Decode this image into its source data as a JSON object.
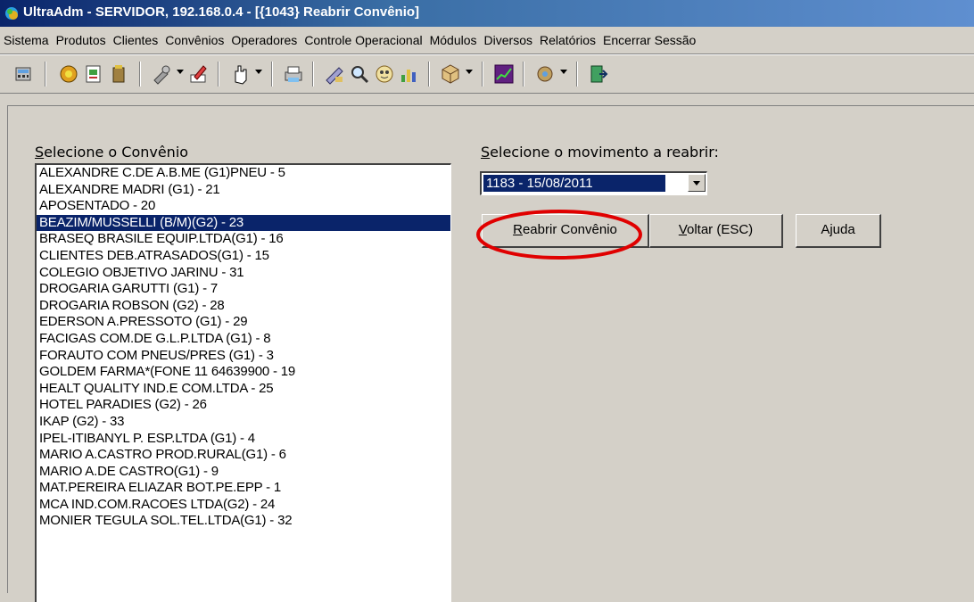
{
  "window": {
    "title": "UltraAdm - SERVIDOR, 192.168.0.4 - [{1043} Reabrir Convênio]"
  },
  "menu": [
    "Sistema",
    "Produtos",
    "Clientes",
    "Convênios",
    "Operadores",
    "Controle Operacional",
    "Módulos",
    "Diversos",
    "Relatórios",
    "Encerrar Sessão"
  ],
  "toolbar": {
    "icons": [
      "calculator-icon",
      "globe-icon",
      "document-icon",
      "trash-icon",
      "tools-icon",
      "edit-icon",
      "hand-icon",
      "printer-icon",
      "pencil-icon",
      "search-icon",
      "people-icon",
      "chart-icon",
      "cube-icon",
      "graph-icon",
      "settings-icon",
      "exit-icon"
    ]
  },
  "form": {
    "convenio_label_accel": "S",
    "convenio_label_rest": "elecione o Convênio",
    "movimento_label_accel": "S",
    "movimento_label_rest": "elecione o movimento a reabrir:",
    "movimento_value": "1183 - 15/08/2011",
    "buttons": {
      "reabrir_accel": "R",
      "reabrir_rest": "eabrir Convênio",
      "voltar_accel": "V",
      "voltar_rest": "oltar (ESC)",
      "ajuda": "Ajuda"
    },
    "highlight_color": "#e00000",
    "selected_color": "#0a246a",
    "convenios": [
      "ALEXANDRE C.DE A.B.ME (G1)PNEU - 5",
      "ALEXANDRE MADRI (G1) - 21",
      "APOSENTADO - 20",
      "BEAZIM/MUSSELLI (B/M)(G2) - 23",
      "BRASEQ BRASILE EQUIP.LTDA(G1) - 16",
      "CLIENTES DEB.ATRASADOS(G1) - 15",
      "COLEGIO OBJETIVO JARINU - 31",
      "DROGARIA GARUTTI (G1) - 7",
      "DROGARIA ROBSON (G2) - 28",
      "EDERSON A.PRESSOTO (G1) - 29",
      "FACIGAS COM.DE G.L.P.LTDA (G1) - 8",
      "FORAUTO COM PNEUS/PRES (G1) - 3",
      "GOLDEM FARMA*(FONE 11 64639900 - 19",
      "HEALT QUALITY IND.E COM.LTDA - 25",
      "HOTEL PARADIES (G2) - 26",
      "IKAP (G2) - 33",
      "IPEL-ITIBANYL P. ESP.LTDA (G1) - 4",
      "MARIO  A.CASTRO PROD.RURAL(G1) - 6",
      "MARIO A.DE CASTRO(G1) - 9",
      "MAT.PEREIRA ELIAZAR BOT.PE.EPP - 1",
      "MCA IND.COM.RACOES LTDA(G2) - 24",
      "MONIER TEGULA SOL.TEL.LTDA(G1) - 32"
    ],
    "selected_index": 3
  }
}
